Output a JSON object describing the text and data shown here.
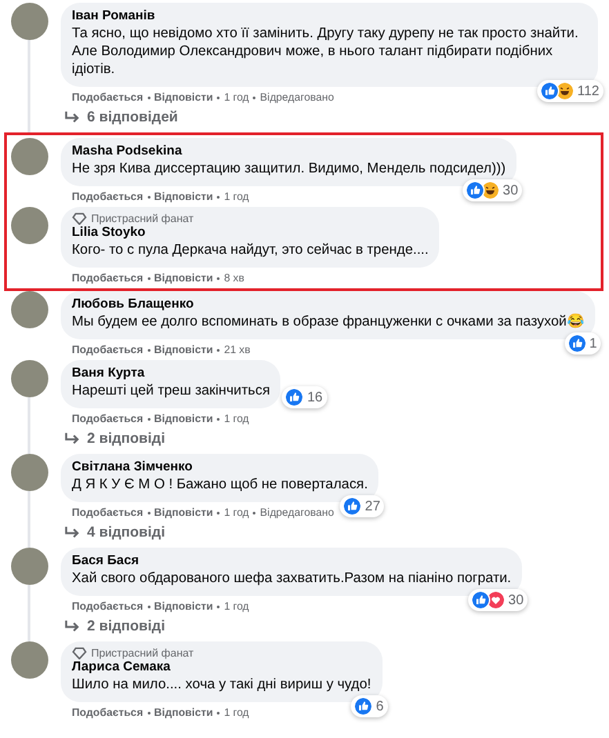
{
  "comments": [
    {
      "author": "Іван Романів",
      "text": "Та ясно, що невідомо хто її замінить. Другу таку дурепу не так просто знайти. Але Володимир Олександрович може, в нього талант підбирати подібних ідіотів.",
      "reactions": [
        {
          "kind": "like"
        },
        {
          "kind": "haha"
        }
      ],
      "count": "112",
      "like": "Подобається",
      "reply": "Відповісти",
      "time": "1 год",
      "edited": "Відредаговано",
      "replies": "6 відповідей",
      "highlighted": false
    },
    {
      "author": "Masha Podsekina",
      "text": "Не зря Кива диссертацию защитил. Видимо, Мендель подсидел)))",
      "reactions": [
        {
          "kind": "like"
        },
        {
          "kind": "haha"
        }
      ],
      "count": "30",
      "like": "Подобається",
      "reply": "Відповісти",
      "time": "1 год",
      "highlighted": true
    },
    {
      "badge": "Пристрасний фанат",
      "author": "Lilia Stoyko",
      "text": "Кого- то с пула Деркача найдут, это сейчас в тренде....",
      "like": "Подобається",
      "reply": "Відповісти",
      "time": "8 хв",
      "highlighted": true
    },
    {
      "author": "Любовь Блащенко",
      "text": "Мы будем ее долго вспоминать в образе француженки с очками за пазухой😂",
      "reactions": [
        {
          "kind": "like"
        }
      ],
      "count": "1",
      "like": "Подобається",
      "reply": "Відповісти",
      "time": "21 хв",
      "highlighted": false
    },
    {
      "author": "Ваня Курта",
      "text": "Нарешті цей треш закінчиться",
      "reactions": [
        {
          "kind": "like"
        }
      ],
      "count": "16",
      "like": "Подобається",
      "reply": "Відповісти",
      "time": "1 год",
      "replies": "2 відповіді",
      "highlighted": false
    },
    {
      "author": "Світлана Зімченко",
      "text": "Д Я К У Є М О ! Бажано щоб не поверталася.",
      "reactions": [
        {
          "kind": "like"
        }
      ],
      "count": "27",
      "like": "Подобається",
      "reply": "Відповісти",
      "time": "1 год",
      "edited": "Відредаговано",
      "replies": "4 відповіді",
      "highlighted": false
    },
    {
      "author": "Бася Бася",
      "text": "Хай свого обдарованого шефа захватить.Разом на піаніно пограти.",
      "reactions": [
        {
          "kind": "like"
        },
        {
          "kind": "love"
        }
      ],
      "count": "30",
      "like": "Подобається",
      "reply": "Відповісти",
      "time": "1 год",
      "replies": "2 відповіді",
      "highlighted": false
    },
    {
      "badge": "Пристрасний фанат",
      "author": "Лариса Семака",
      "text": "Шило на мило.... хоча у такі дні вириш у чудо!",
      "reactions": [
        {
          "kind": "like"
        }
      ],
      "count": "6",
      "like": "Подобається",
      "reply": "Відповісти",
      "time": "1 год",
      "highlighted": false
    }
  ]
}
